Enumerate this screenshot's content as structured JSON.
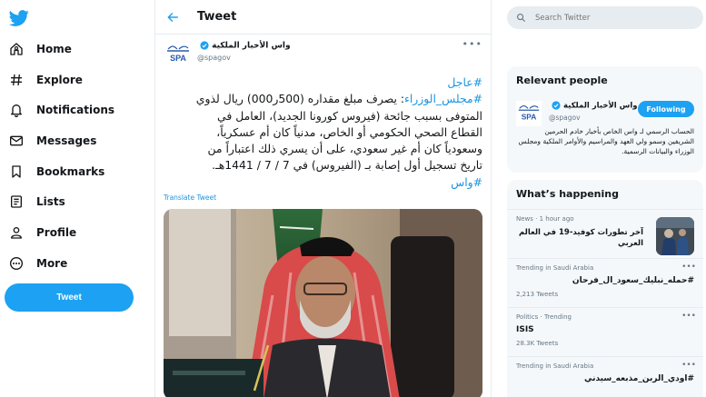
{
  "nav": {
    "items": [
      {
        "label": "Home",
        "icon": "home-icon"
      },
      {
        "label": "Explore",
        "icon": "hashtag-icon"
      },
      {
        "label": "Notifications",
        "icon": "bell-icon"
      },
      {
        "label": "Messages",
        "icon": "envelope-icon"
      },
      {
        "label": "Bookmarks",
        "icon": "bookmark-icon"
      },
      {
        "label": "Lists",
        "icon": "list-icon"
      },
      {
        "label": "Profile",
        "icon": "person-icon"
      },
      {
        "label": "More",
        "icon": "more-circle-icon"
      }
    ],
    "tweet_button": "Tweet"
  },
  "main": {
    "title": "Tweet",
    "author": {
      "name": "واس الأخبار الملكية",
      "handle": "@spagov",
      "avatar_text": "SPA"
    },
    "tweet": {
      "line1_tag": "#عاجل",
      "line2_tag": "#مجلس_الوزراء",
      "line2_text": ": يصرف مبلغ مقداره (500ر000) ريال لذوي",
      "line3": "المتوفى بسبب جائحة (فيروس كورونا الجديد)، العامل في",
      "line4": "القطاع الصحي الحكومي أو الخاص، مدنياً كان أم عسكرياً،",
      "line5": "وسعودياً كان أم غير سعودي، على أن يسري ذلك اعتباراً من",
      "line6": "تاريخ تسجيل أول إصابة بـ (الفيروس) في 7 / 7 / 1441هـ.",
      "line7_tag": "#واس"
    },
    "translate_label": "Translate Tweet"
  },
  "side": {
    "search_placeholder": "Search Twitter",
    "relevant": {
      "title": "Relevant people",
      "name": "واس الأخبار الملكية",
      "handle": "@spagov",
      "follow_label": "Following",
      "bio": "الحساب الرسمي لـ واس الخاص بأخبار خادم الحرمين الشريفين وسمو ولي العهد والمراسيم والأوامر الملكية ومجلس الوزراء والبيانات الرسمية."
    },
    "happening": {
      "title": "What’s happening",
      "trends": [
        {
          "meta": "News · 1 hour ago",
          "name": "آخر تطورات كوفيد-19 في العالم العربي",
          "count": ""
        },
        {
          "meta": "Trending in Saudi Arabia",
          "name": "#حمله_نبليك_سعود_ال_فرحان",
          "count": "2,213 Tweets"
        },
        {
          "meta": "Politics · Trending",
          "name": "ISIS",
          "count": "28.3K Tweets"
        },
        {
          "meta": "Trending in Saudi Arabia",
          "name": "#اودي_الربن_مذبعه_سيدني",
          "count": ""
        }
      ]
    }
  },
  "colors": {
    "accent": "#1da1f2",
    "link": "#1b95e0",
    "muted": "#657786",
    "card_bg": "#f5f8fa"
  }
}
